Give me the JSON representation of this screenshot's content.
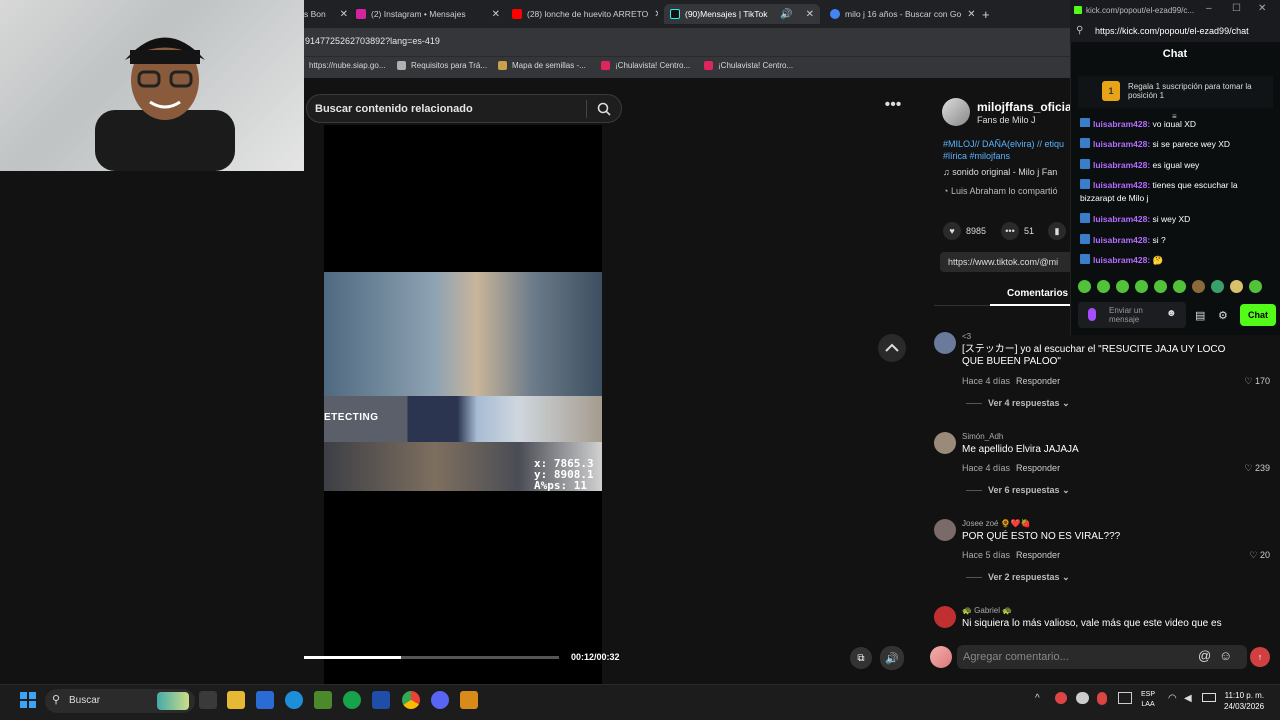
{
  "browser": {
    "tabs": [
      {
        "label": "s Bon",
        "color": "#666"
      },
      {
        "label": "(2) Instagram • Mensajes",
        "color": "#d6249f"
      },
      {
        "label": "(28) lonche de huevito ARRETO",
        "color": "#ff0000"
      },
      {
        "label": "(90)Mensajes | TikTok",
        "color": "#111"
      },
      {
        "label": "milo j 16 años - Buscar con Go",
        "color": "#4285f4"
      }
    ],
    "url": "9147725262703892?lang=es-419",
    "bookmarks": [
      {
        "label": "https://nube.siap.go...",
        "color": "#888"
      },
      {
        "label": "Requisitos para Trá...",
        "color": "#b0b0b0"
      },
      {
        "label": "Mapa de semillas -...",
        "color": "#c9a14a"
      },
      {
        "label": "¡Chulavista! Centro...",
        "color": "#e0245e"
      },
      {
        "label": "¡Chulavista! Centro...",
        "color": "#e0245e"
      }
    ]
  },
  "tiktok": {
    "search_placeholder": "Buscar contenido relacionado",
    "video": {
      "detect_text": "ETECTING",
      "coord_x": "x: 7865.3",
      "coord_y": "y: 8908.1",
      "coord_z": "A%ps: 11",
      "progress": 0.38,
      "time": "00:12/00:32"
    },
    "post": {
      "username": "milojffans_oficia",
      "fans": "Fans de Milo J",
      "desc_line1": "#MILOJ// DAÑA(elvira) // etiqu",
      "desc_line2": "#lírica #milojfans",
      "sound": "sonido original - Milo j Fan",
      "shared": "Luis Abraham lo compartió",
      "likes": "8985",
      "comments_count": "51",
      "link": "https://www.tiktok.com/@mi",
      "comments_tab": "Comentarios (51)"
    },
    "comments": [
      {
        "user": "<3",
        "text": "[ステッカー] yo al escuchar el \"RESUCITE JAJA UY LOCO QUE BUEEN PALOO\"",
        "time": "Hace 4 días",
        "reply": "Responder",
        "likes": "170",
        "replies": "Ver 4 respuestas",
        "color": "#6a7a9a"
      },
      {
        "user": "Simón_Adh",
        "text": "Me apellido Elvira JAJAJA",
        "time": "Hace 4 días",
        "reply": "Responder",
        "likes": "239",
        "replies": "Ver 6 respuestas",
        "color": "#9a8a7a"
      },
      {
        "user": "Josee zoé 🌻❤️🍓",
        "text": "POR QUÉ ESTO NO ES VIRAL???",
        "time": "Hace 5 días",
        "reply": "Responder",
        "likes": "20",
        "replies": "Ver 2 respuestas",
        "color": "#7a6a6a"
      },
      {
        "user": "🐢 Gabriel 🐢",
        "text": "Ni siquiera lo más valioso, vale más que este video que es",
        "color": "#c03030"
      }
    ],
    "add_comment_placeholder": "Agregar comentario..."
  },
  "kick": {
    "title_url": "kick.com/popout/el-ezad99/c...",
    "url": "https://kick.com/popout/el-ezad99/chat",
    "chat_title": "Chat",
    "gift_rank": "1",
    "gift_text": "Regala 1 suscripción para tomar la posición 1",
    "messages": [
      {
        "user": "luisabram428:",
        "text": " yo igual XD"
      },
      {
        "user": "luisabram428:",
        "text": " si se parece wey XD"
      },
      {
        "user": "luisabram428:",
        "text": " es igual wey"
      },
      {
        "user": "luisabram428:",
        "text": " tienes que escuchar la bizzarapt de Milo j"
      },
      {
        "user": "luisabram428:",
        "text": " si wey XD"
      },
      {
        "user": "luisabram428:",
        "text": " si ?"
      },
      {
        "user": "luisabram428:",
        "text": " 🤔"
      }
    ],
    "input_placeholder": "Enviar un mensaje",
    "chat_button": "Chat",
    "accent": "#53fc18"
  },
  "taskbar": {
    "search": "Buscar",
    "lang_line1": "ESP",
    "lang_line2": "LAA",
    "time": "11:10 p. m.",
    "date": "24/03/2026"
  }
}
